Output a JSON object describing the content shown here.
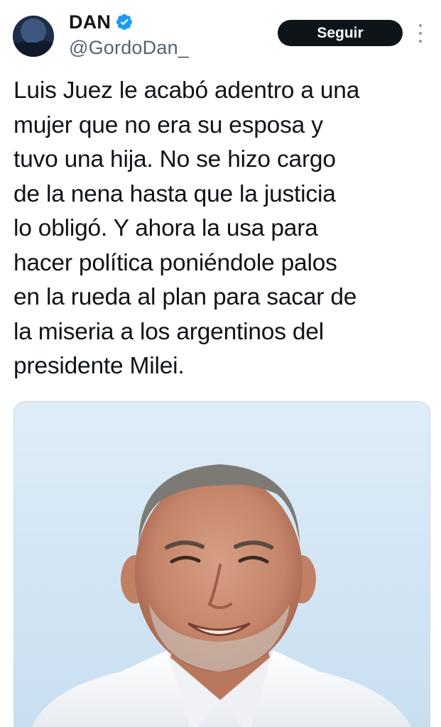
{
  "tweet": {
    "author": {
      "display_name": "DAN",
      "handle": "@GordoDan_",
      "verified": true,
      "verified_color": "#1d9bf0"
    },
    "follow_label": "Seguir",
    "more_icon": "more-vertical-icon",
    "text": "Luis Juez le acabó adentro a una\nmujer que no era su esposa y\ntuvo una hija. No se hizo cargo\nde la nena hasta que la justicia\nlo obligó. Y ahora la usa para\nhacer política poniéndole palos\nen la rueda al plan para sacar de\nla miseria a los argentinos del\npresidente Milei.",
    "media": {
      "type": "photo"
    }
  },
  "colors": {
    "text": "#0f1419",
    "secondary": "#536471",
    "button_bg": "#0f1419",
    "button_text": "#ffffff",
    "accent": "#1d9bf0"
  }
}
